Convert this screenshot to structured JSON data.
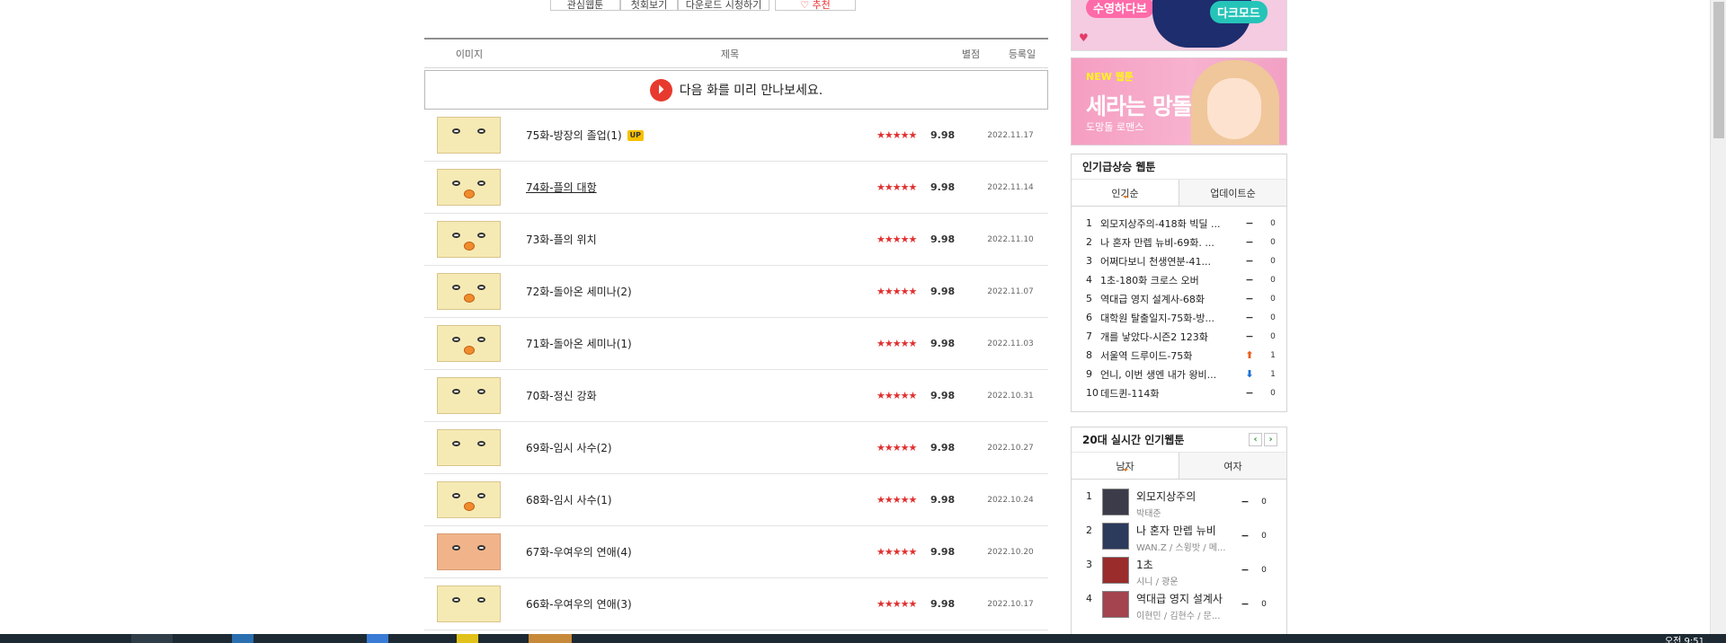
{
  "header": {
    "tool_buttons": [
      "관심웹툰",
      "첫회보기",
      "다운로드 시청하기",
      "♡ 추천"
    ],
    "columns": {
      "image": "이미지",
      "title": "제목",
      "rating": "별점",
      "date": "등록일"
    },
    "notice": "다음 화를 미리 만나보세요."
  },
  "episodes": [
    {
      "title": "75화-방장의 졸업(1)",
      "badge": "UP",
      "stars": "★★★★★",
      "score": "9.98",
      "date": "2022.11.17"
    },
    {
      "title": "74화-플의 대항",
      "badge": "",
      "stars": "★★★★★",
      "score": "9.98",
      "date": "2022.11.14"
    },
    {
      "title": "73화-플의 위치",
      "badge": "",
      "stars": "★★★★★",
      "score": "9.98",
      "date": "2022.11.10"
    },
    {
      "title": "72화-돌아온 세미나(2)",
      "badge": "",
      "stars": "★★★★★",
      "score": "9.98",
      "date": "2022.11.07"
    },
    {
      "title": "71화-돌아온 세미나(1)",
      "badge": "",
      "stars": "★★★★★",
      "score": "9.98",
      "date": "2022.11.03"
    },
    {
      "title": "70화-정신 강화",
      "badge": "",
      "stars": "★★★★★",
      "score": "9.98",
      "date": "2022.10.31"
    },
    {
      "title": "69화-임시 사수(2)",
      "badge": "",
      "stars": "★★★★★",
      "score": "9.98",
      "date": "2022.10.27"
    },
    {
      "title": "68화-임시 사수(1)",
      "badge": "",
      "stars": "★★★★★",
      "score": "9.98",
      "date": "2022.10.24"
    },
    {
      "title": "67화-우여우의 연애(4)",
      "badge": "",
      "stars": "★★★★★",
      "score": "9.98",
      "date": "2022.10.20"
    },
    {
      "title": "66화-우여우의 연애(3)",
      "badge": "",
      "stars": "★★★★★",
      "score": "9.98",
      "date": "2022.10.17"
    }
  ],
  "sidebar": {
    "banner1": {
      "left": "수영하다보",
      "right": "다크모드"
    },
    "banner2": {
      "tag": "NEW 웹툰",
      "title": "세라는 망돌",
      "sub": "도망돌 로맨스"
    },
    "rising": {
      "title": "인기급상승 웹툰",
      "tabs": [
        "인기순",
        "업데이트순"
      ],
      "items": [
        {
          "rank": "1",
          "title": "외모지상주의-418화 빅딜 ...",
          "change": "−",
          "dir": "eq",
          "value": "0"
        },
        {
          "rank": "2",
          "title": "나 혼자 만렙 뉴비-69화. ...",
          "change": "−",
          "dir": "eq",
          "value": "0"
        },
        {
          "rank": "3",
          "title": "어쩌다보니 천생연분-41...",
          "change": "−",
          "dir": "eq",
          "value": "0"
        },
        {
          "rank": "4",
          "title": "1초-180화 크로스 오버",
          "change": "−",
          "dir": "eq",
          "value": "0"
        },
        {
          "rank": "5",
          "title": "역대급 영지 설계사-68화",
          "change": "−",
          "dir": "eq",
          "value": "0"
        },
        {
          "rank": "6",
          "title": "대학원 탈출일지-75화-방...",
          "change": "−",
          "dir": "eq",
          "value": "0"
        },
        {
          "rank": "7",
          "title": "개를 낳았다-시즌2 123화",
          "change": "−",
          "dir": "eq",
          "value": "0"
        },
        {
          "rank": "8",
          "title": "서울역 드루이드-75화",
          "change": "⬆",
          "dir": "up",
          "value": "1"
        },
        {
          "rank": "9",
          "title": "언니, 이번 생엔 내가 왕비...",
          "change": "⬇",
          "dir": "dn",
          "value": "1"
        },
        {
          "rank": "10",
          "title": "데드퀸-114화",
          "change": "−",
          "dir": "eq",
          "value": "0"
        }
      ]
    },
    "realtime": {
      "title": "20대 실시간 인기웹툰",
      "prev": "‹",
      "next": "›",
      "tabs": [
        "남자",
        "여자"
      ],
      "items": [
        {
          "rank": "1",
          "title": "외모지상주의",
          "author": "박태준",
          "change": "−",
          "value": "0"
        },
        {
          "rank": "2",
          "title": "나 혼자 만렙 뉴비",
          "author": "WAN.Z / 스윙밧 / 메...",
          "change": "−",
          "value": "0"
        },
        {
          "rank": "3",
          "title": "1초",
          "author": "시니 / 광운",
          "change": "−",
          "value": "0"
        },
        {
          "rank": "4",
          "title": "역대급 영지 설계사",
          "author": "이현민 / 김현수 / 문...",
          "change": "−",
          "value": "0"
        }
      ]
    }
  },
  "taskbar": {
    "clock": "오전 9:51"
  }
}
